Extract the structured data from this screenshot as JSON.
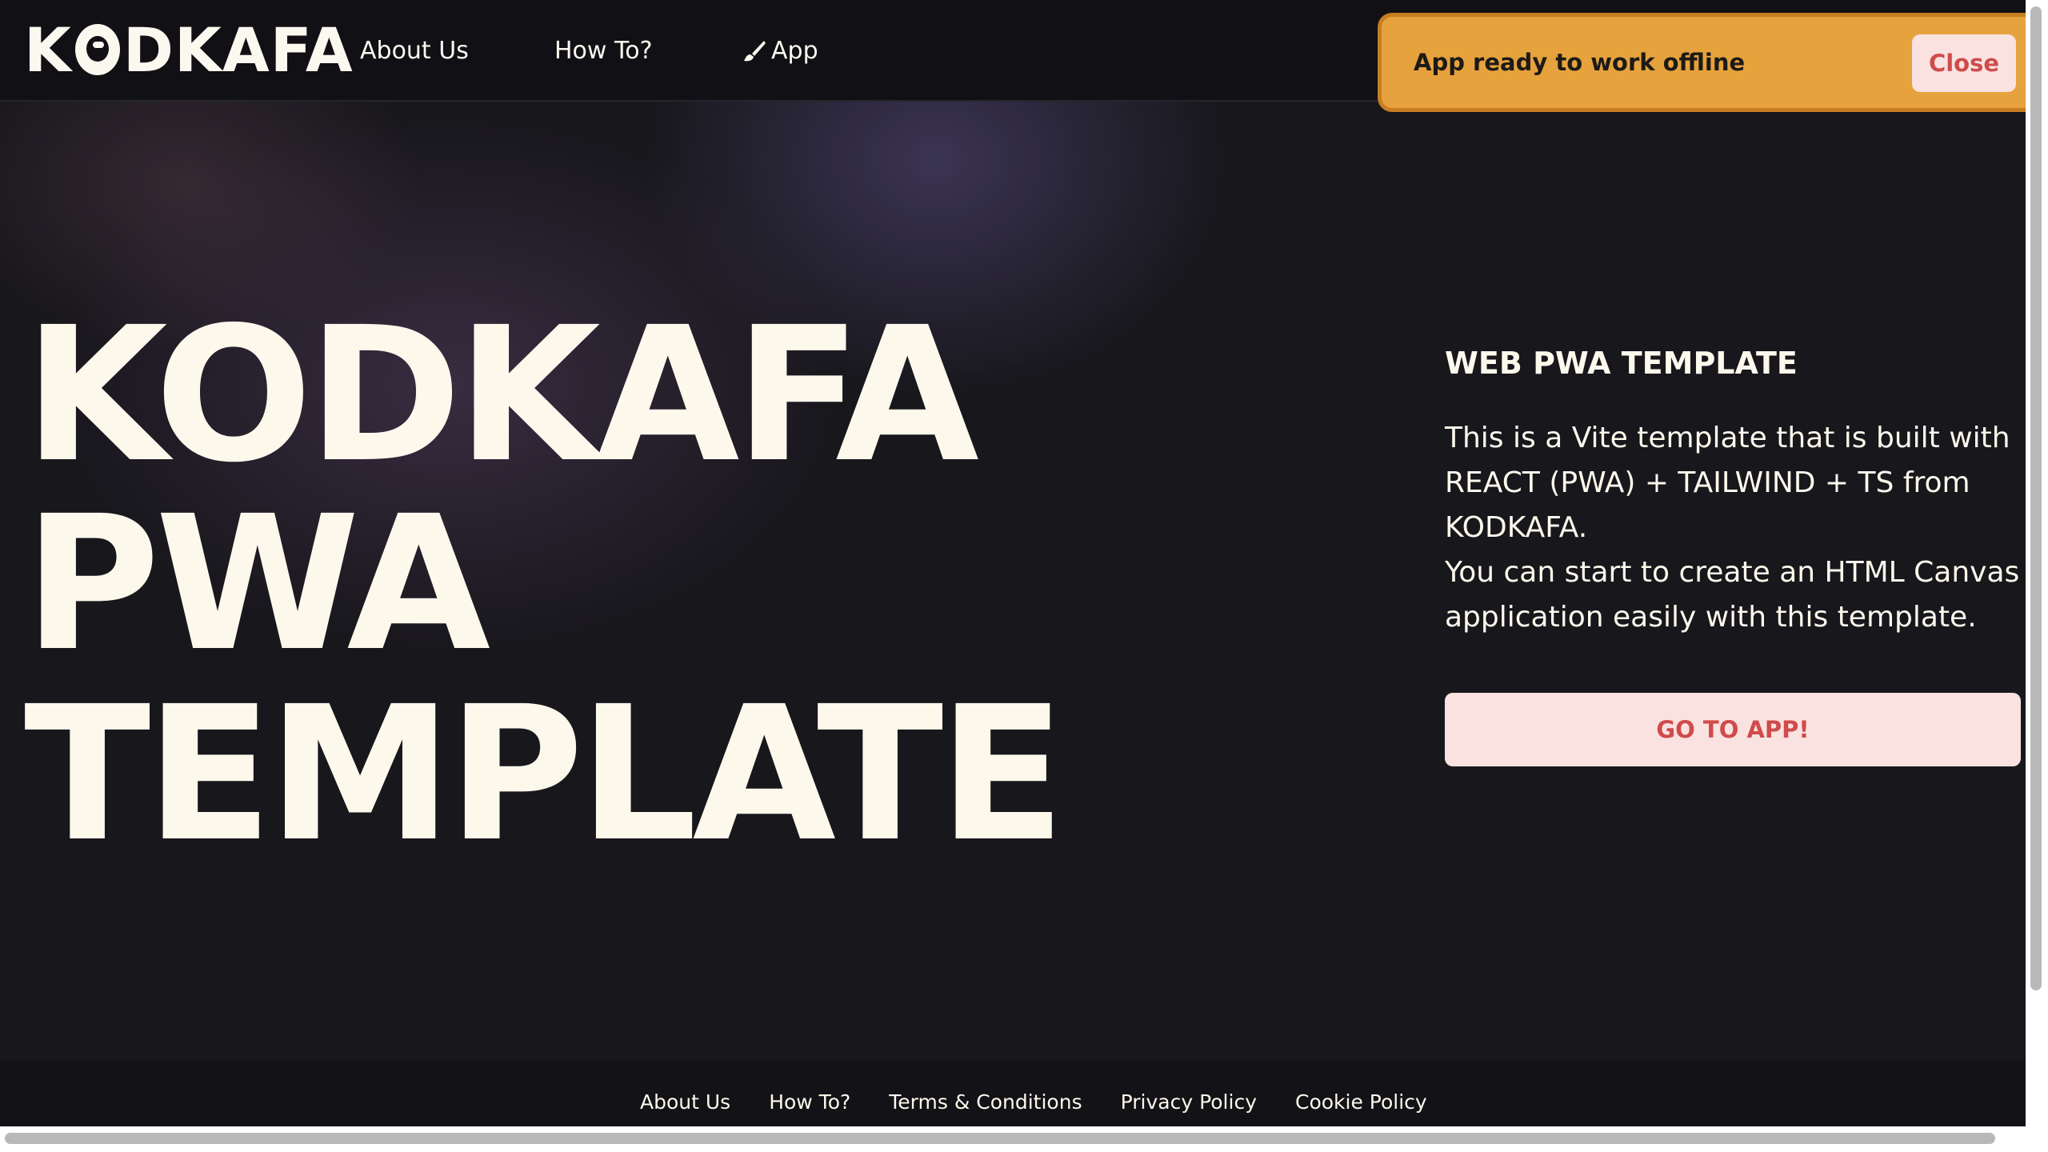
{
  "header": {
    "logo_text_left": "K",
    "logo_text_right": "DKAFA",
    "nav": [
      {
        "label": "About Us"
      },
      {
        "label": "How To?"
      },
      {
        "label": "App",
        "icon": "brush-icon"
      }
    ]
  },
  "toast": {
    "message": "App ready to work offline",
    "close_label": "Close",
    "color": "#e6a23c"
  },
  "hero": {
    "line1": "KODKAFA",
    "line2": "PWA",
    "line3": "TEMPLATE"
  },
  "panel": {
    "title": "WEB PWA TEMPLATE",
    "paragraph1": "This is a Vite template that is built with REACT (PWA) + TAILWIND + TS from KODKAFA.",
    "paragraph2": "You can start to create an HTML Canvas application easily with this template.",
    "cta_label": "GO TO APP!"
  },
  "footer": {
    "links": [
      "About Us",
      "How To?",
      "Terms & Conditions",
      "Privacy Policy",
      "Cookie Policy"
    ]
  },
  "colors": {
    "background": "#18171c",
    "text": "#fcf8ec",
    "accent": "#d04b4b",
    "button_bg": "#f9e2e0"
  }
}
